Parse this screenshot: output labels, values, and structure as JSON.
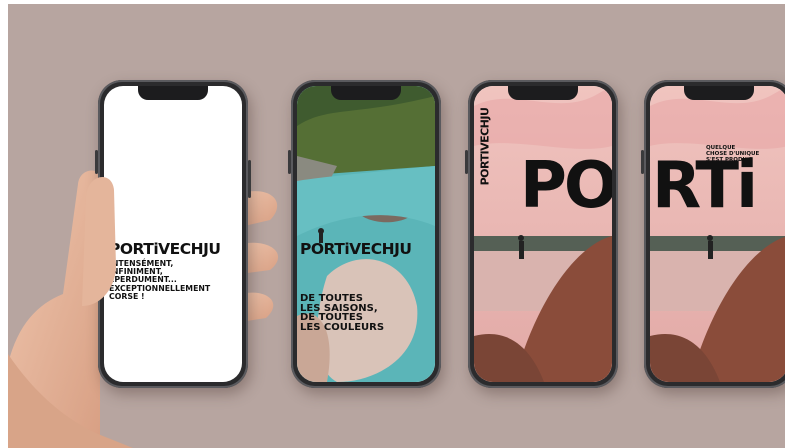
{
  "phones": [
    {
      "brand": "PORTiVECHJU",
      "tagline_lines": [
        "INTENSÉMENT,",
        "INFINIMENT,",
        "ÉPERDUMENT...",
        "EXCEPTIONNELLEMENT",
        "CORSE !"
      ]
    },
    {
      "brand": "PORTiVECHJU",
      "tagline_lines": [
        "DE TOUTES",
        "LES SAISONS,",
        "DE TOUTES",
        "LES COULEURS"
      ]
    },
    {
      "brand_vertical": "PORTIVECHJU",
      "big_letters": "PO"
    },
    {
      "small_lines": [
        "QUELQUE",
        "CHOSE D'UNIQUE",
        "S'EST PRODUIT"
      ],
      "big_letters": "RTi"
    }
  ],
  "colors": {
    "background": "#b7a5a0",
    "phone_frame": "#2b2b2d",
    "text": "#111111",
    "sky_pink": "#e8b4b0",
    "water": "#56b4b4"
  }
}
